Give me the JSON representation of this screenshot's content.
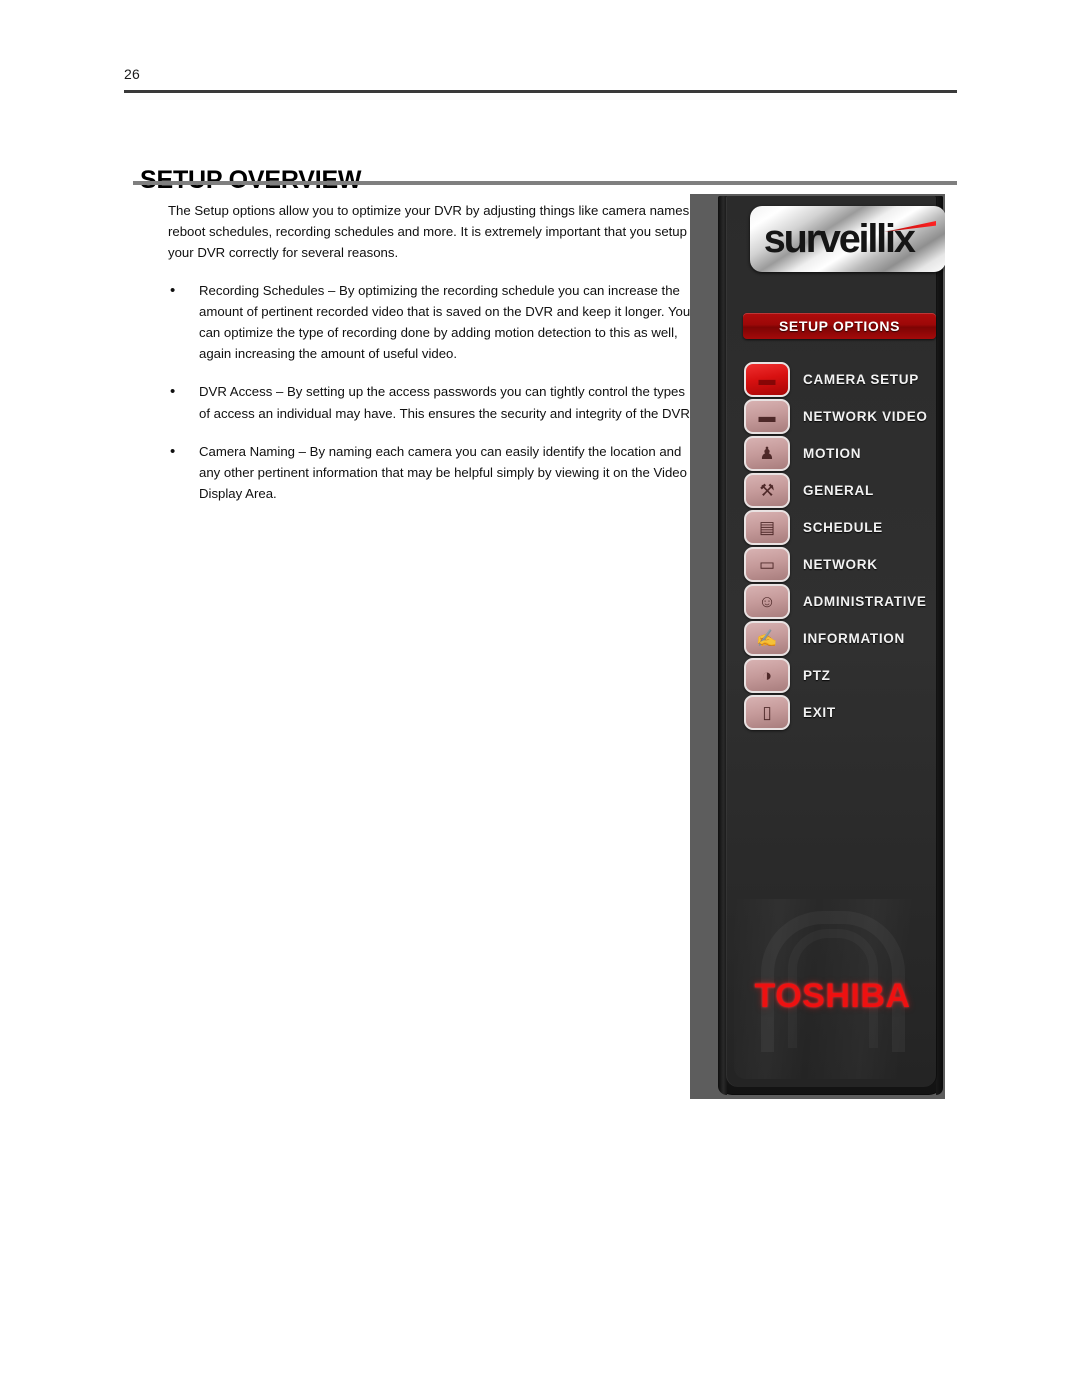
{
  "page": {
    "number": "26",
    "title": "SETUP OVERVIEW"
  },
  "content": {
    "intro": "The Setup options allow you to optimize your DVR by adjusting things like camera names, reboot schedules, recording schedules and more. It is extremely important that you setup your DVR correctly for several reasons.",
    "bullet_marker": "•",
    "bullets": [
      "Recording Schedules – By optimizing the recording schedule you can increase the amount of pertinent recorded video that is saved on the DVR and keep it longer. You can optimize the type of recording done by adding motion detection to this as well, again increasing the amount of useful video.",
      "DVR Access – By setting up the access passwords you can tightly control the types of access an individual may have. This ensures the security and integrity of the DVR.",
      "Camera Naming – By naming each camera you can easily identify the location and any other pertinent information that may be helpful simply by viewing it on the Video Display Area."
    ]
  },
  "dvr_panel": {
    "brand_logo": "surveillix",
    "banner_label": "SETUP OPTIONS",
    "footer_logo": "TOSHIBA",
    "colors": {
      "panel_bg": "#262626",
      "banner_red": "#9c0808",
      "active_icon_red": "#d81111",
      "inactive_icon": "#c59a9a",
      "toshiba_red": "#ee1111",
      "label_text": "#f2f2f2"
    },
    "menu_items": [
      {
        "label": "CAMERA SETUP",
        "icon": "camera-icon",
        "glyph": "▬",
        "active": true
      },
      {
        "label": "NETWORK VIDEO",
        "icon": "network-video-icon",
        "glyph": "▬",
        "active": false
      },
      {
        "label": "MOTION",
        "icon": "running-person-icon",
        "glyph": "♟",
        "active": false
      },
      {
        "label": "GENERAL",
        "icon": "tools-icon",
        "glyph": "⚒",
        "active": false
      },
      {
        "label": "SCHEDULE",
        "icon": "calendar-book-icon",
        "glyph": "▤",
        "active": false
      },
      {
        "label": "NETWORK",
        "icon": "two-monitors-icon",
        "glyph": "▭",
        "active": false
      },
      {
        "label": "ADMINISTRATIVE",
        "icon": "person-face-icon",
        "glyph": "☺",
        "active": false
      },
      {
        "label": "INFORMATION",
        "icon": "hand-document-icon",
        "glyph": "✍",
        "active": false
      },
      {
        "label": "PTZ",
        "icon": "dome-camera-icon",
        "glyph": "◑",
        "active": false
      },
      {
        "label": "EXIT",
        "icon": "door-exit-icon",
        "glyph": "▯",
        "active": false
      }
    ]
  }
}
